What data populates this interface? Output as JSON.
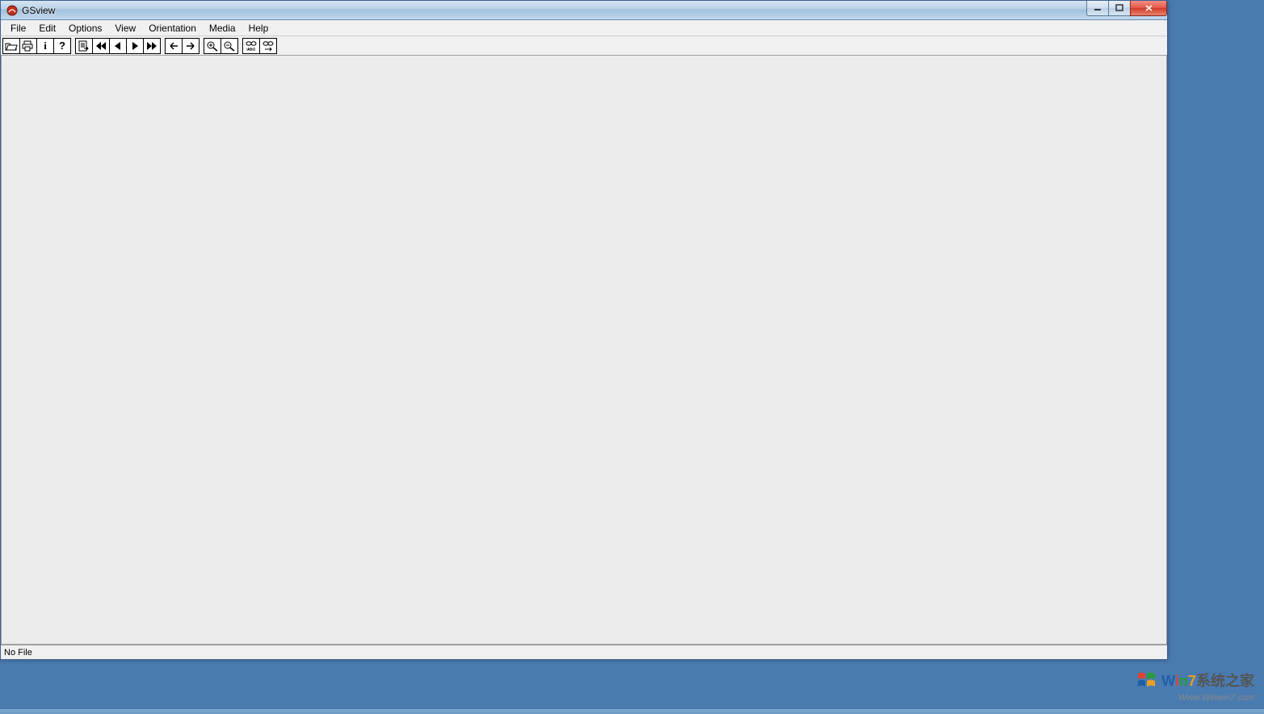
{
  "window": {
    "title": "GSview"
  },
  "menu": {
    "items": [
      "File",
      "Edit",
      "Options",
      "View",
      "Orientation",
      "Media",
      "Help"
    ]
  },
  "toolbar": {
    "buttons": [
      {
        "name": "open-button",
        "icon": "folder-open-icon"
      },
      {
        "name": "print-button",
        "icon": "printer-icon"
      },
      {
        "name": "info-button",
        "icon": "info-icon",
        "glyph": "i"
      },
      {
        "name": "help-button",
        "icon": "question-icon",
        "glyph": "?"
      },
      {
        "sep": true
      },
      {
        "name": "goto-page-button",
        "icon": "document-arrow-icon"
      },
      {
        "name": "first-page-button",
        "icon": "rewind-icon"
      },
      {
        "name": "prev-page-button",
        "icon": "triangle-left-icon"
      },
      {
        "name": "next-page-button",
        "icon": "triangle-right-icon"
      },
      {
        "name": "last-page-button",
        "icon": "fastforward-icon"
      },
      {
        "sep": true
      },
      {
        "name": "back-button",
        "icon": "arrow-left-icon"
      },
      {
        "name": "forward-button",
        "icon": "arrow-right-icon"
      },
      {
        "sep": true
      },
      {
        "name": "zoom-in-button",
        "icon": "magnify-plus-icon"
      },
      {
        "name": "zoom-out-button",
        "icon": "magnify-minus-icon"
      },
      {
        "sep": true
      },
      {
        "name": "find-button",
        "icon": "find-text-icon"
      },
      {
        "name": "find-next-button",
        "icon": "find-next-icon"
      }
    ]
  },
  "status": {
    "text": "No File"
  },
  "watermark": {
    "brand_w": "W",
    "brand_i": "i",
    "brand_n": "n",
    "brand_7": "7",
    "brand_rest": "系统之家",
    "url": "Www.Winwin7.com"
  }
}
